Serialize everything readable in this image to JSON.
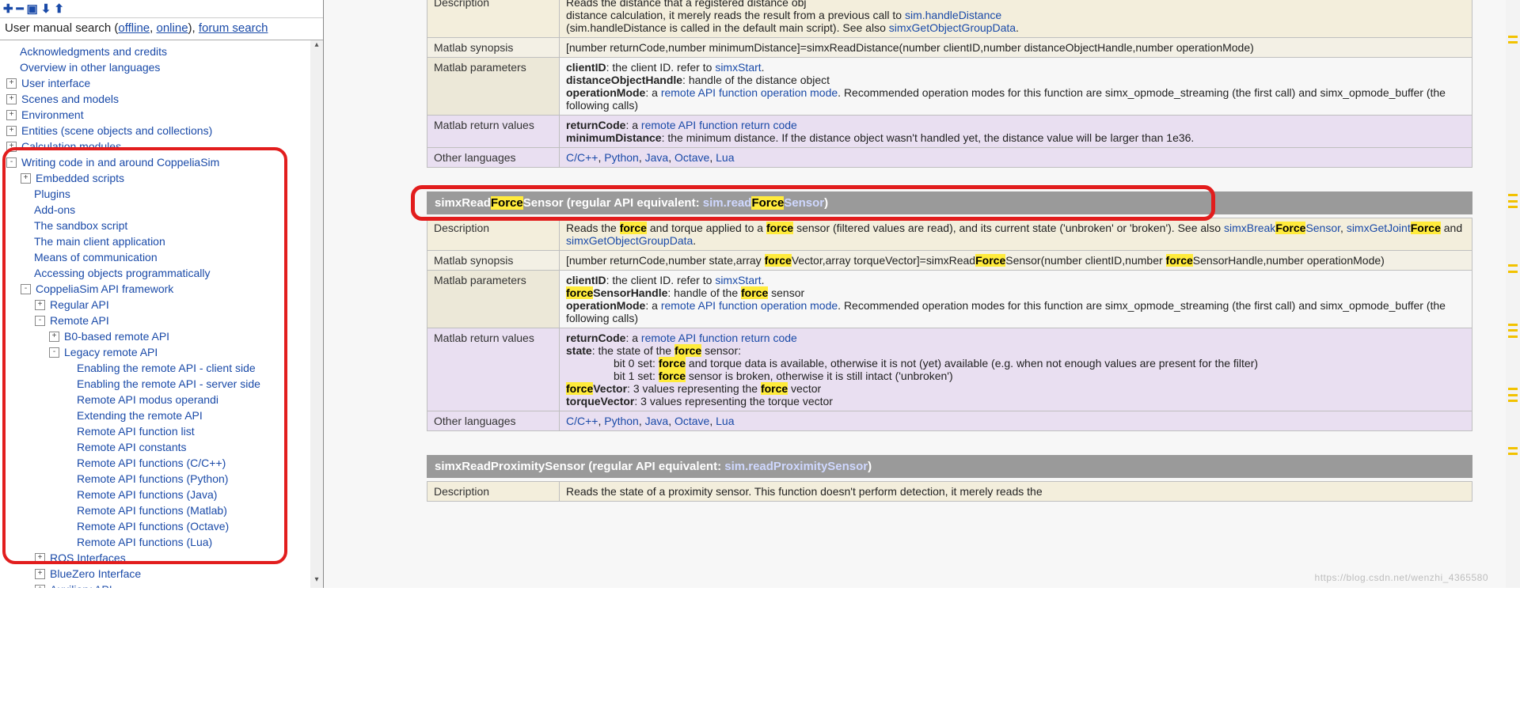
{
  "toolbar": {
    "icons": [
      "add-icon",
      "remove-icon",
      "collapse-icon",
      "down-icon",
      "up-icon"
    ],
    "glyphs": [
      "✚",
      "━",
      "▣",
      "⬇",
      "⬆"
    ]
  },
  "search": {
    "prefix": "User manual search (",
    "offline": "offline",
    "sep1": ", ",
    "online": "online",
    "sep2": "), ",
    "forum": "forum search"
  },
  "tree": [
    {
      "d": 0,
      "box": "",
      "label": "Acknowledgments and credits"
    },
    {
      "d": 0,
      "box": "",
      "label": "Overview in other languages"
    },
    {
      "d": 0,
      "box": "+",
      "label": "User interface"
    },
    {
      "d": 0,
      "box": "+",
      "label": "Scenes and models"
    },
    {
      "d": 0,
      "box": "+",
      "label": "Environment"
    },
    {
      "d": 0,
      "box": "+",
      "label": "Entities (scene objects and collections)"
    },
    {
      "d": 0,
      "box": "+",
      "label": "Calculation modules"
    },
    {
      "d": 0,
      "box": "-",
      "label": "Writing code in and around CoppeliaSim"
    },
    {
      "d": 1,
      "box": "+",
      "label": "Embedded scripts"
    },
    {
      "d": 1,
      "box": "",
      "label": "Plugins"
    },
    {
      "d": 1,
      "box": "",
      "label": "Add-ons"
    },
    {
      "d": 1,
      "box": "",
      "label": "The sandbox script"
    },
    {
      "d": 1,
      "box": "",
      "label": "The main client application"
    },
    {
      "d": 1,
      "box": "",
      "label": "Means of communication"
    },
    {
      "d": 1,
      "box": "",
      "label": "Accessing objects programmatically"
    },
    {
      "d": 1,
      "box": "-",
      "label": "CoppeliaSim API framework"
    },
    {
      "d": 2,
      "box": "+",
      "label": "Regular API"
    },
    {
      "d": 2,
      "box": "-",
      "label": "Remote API"
    },
    {
      "d": 3,
      "box": "+",
      "label": "B0-based remote API"
    },
    {
      "d": 3,
      "box": "-",
      "label": "Legacy remote API"
    },
    {
      "d": 4,
      "box": "",
      "label": "Enabling the remote API - client side"
    },
    {
      "d": 4,
      "box": "",
      "label": "Enabling the remote API - server side"
    },
    {
      "d": 4,
      "box": "",
      "label": "Remote API modus operandi"
    },
    {
      "d": 4,
      "box": "",
      "label": "Extending the remote API"
    },
    {
      "d": 4,
      "box": "",
      "label": "Remote API function list"
    },
    {
      "d": 4,
      "box": "",
      "label": "Remote API constants"
    },
    {
      "d": 4,
      "box": "",
      "label": "Remote API functions (C/C++)"
    },
    {
      "d": 4,
      "box": "",
      "label": "Remote API functions (Python)"
    },
    {
      "d": 4,
      "box": "",
      "label": "Remote API functions (Java)"
    },
    {
      "d": 4,
      "box": "",
      "label": "Remote API functions (Matlab)"
    },
    {
      "d": 4,
      "box": "",
      "label": "Remote API functions (Octave)"
    },
    {
      "d": 4,
      "box": "",
      "label": "Remote API functions (Lua)"
    },
    {
      "d": 2,
      "box": "+",
      "label": "ROS Interfaces"
    },
    {
      "d": 2,
      "box": "+",
      "label": "BlueZero Interface"
    },
    {
      "d": 2,
      "box": "+",
      "label": "Auxiliary API"
    }
  ],
  "funcA": {
    "rows": {
      "description": "Description",
      "synopsis": "Matlab synopsis",
      "params": "Matlab parameters",
      "ret": "Matlab return values",
      "lang": "Other languages"
    },
    "desc_pre": "Reads the distance that a registered distance obj",
    "desc_l2a": "distance calculation, it merely reads the result from a previous call to ",
    "desc_link1": "sim.handleDistance",
    "desc_l3a": "(sim.handleDistance is called in the default main script). See also ",
    "desc_link2": "simxGetObjectGroupData",
    "syn": "[number returnCode,number minimumDistance]=simxReadDistance(number clientID,number distanceObjectHandle,number operationMode)",
    "p_client_pre": "clientID",
    "p_client_txt": ": the client ID. refer to ",
    "p_client_link": "simxStart",
    "p_doh_pre": "distanceObjectHandle",
    "p_doh_txt": ": handle of the distance object",
    "p_op_pre": "operationMode",
    "p_op_txt": ": a ",
    "p_op_link": "remote API function operation mode",
    "p_op_tail": ". Recommended operation modes for this function are simx_opmode_streaming (the first call) and simx_opmode_buffer (the following calls)",
    "r_rc_pre": "returnCode",
    "r_rc_txt": ": a ",
    "r_rc_link": "remote API function return code",
    "r_md_pre": "minimumDistance",
    "r_md_txt": ": the minimum distance. If the distance object wasn't handled yet, the distance value will be larger than 1e36.",
    "lang_items": [
      "C/C++",
      "Python",
      "Java",
      "Octave",
      "Lua"
    ]
  },
  "funcB": {
    "title_pre": "simxRead",
    "title_hl1": "Force",
    "title_mid": "Sensor (regular API equivalent: ",
    "title_api_pre": "sim.read",
    "title_hl2": "Force",
    "title_api_post": "Sensor",
    "title_close": ")",
    "desc_a": "Reads the ",
    "desc_b": " and torque applied to a ",
    "desc_c": " sensor (filtered values are read), and its current state ('unbroken' or 'broken'). See also ",
    "link_break_pre": "simxBreak",
    "link_break_post": "Sensor",
    "link_joint_pre": "simxGetJoint",
    "link_group": "simxGetObjectGroupData",
    "syn_a": "[number returnCode,number state,array ",
    "syn_b": "Vector,array torqueVector]=simxRead",
    "syn_c": "Sensor(number clientID,number ",
    "syn_d": "SensorHandle,number operationMode)",
    "p_fsh_post": "SensorHandle",
    "p_fsh_txt": ": handle of the ",
    "p_fsh_tail": " sensor",
    "r_state_pre": "state",
    "r_state_txt": ": the state of the ",
    "r_state_tail": " sensor:",
    "r_bit0_a": "bit 0 set: ",
    "r_bit0_b": " and torque data is available, otherwise it is not (yet) available (e.g. when not enough values are present for the filter)",
    "r_bit1_a": "bit 1 set: ",
    "r_bit1_b": " sensor is broken, otherwise it is still intact ('unbroken')",
    "r_fv_post": "Vector",
    "r_fv_txt": ": 3 values representing the ",
    "r_fv_tail": " vector",
    "r_tv_pre": "torqueVector",
    "r_tv_txt": ": 3 values representing the torque vector"
  },
  "funcC": {
    "title": "simxReadProximitySensor (regular API equivalent: ",
    "title_link": "sim.readProximitySensor",
    "title_close": ")",
    "desc": "Reads the state of a proximity sensor. This function doesn't perform detection, it merely reads the"
  },
  "hl_force": "force",
  "hl_Force": "Force",
  "sep_comma": ", ",
  "period": ".",
  "and": " and ",
  "watermark": "https://blog.csdn.net/wenzhi_4365580"
}
